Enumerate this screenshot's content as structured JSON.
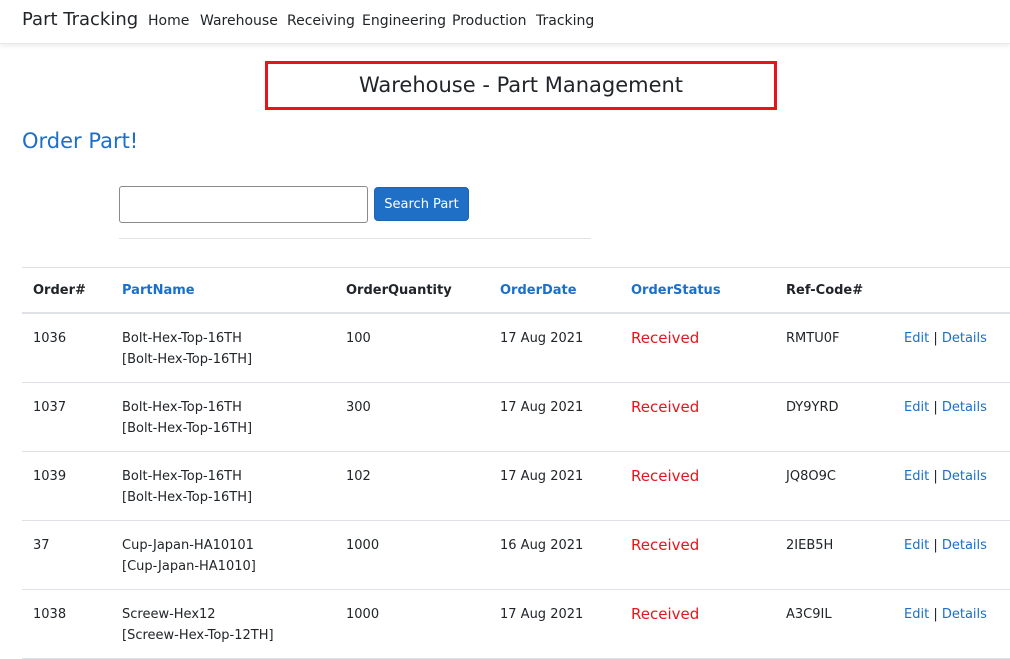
{
  "navbar": {
    "brand": "Part Tracking",
    "links": [
      {
        "label": "Home"
      },
      {
        "label": "Warehouse"
      },
      {
        "label": "Receiving"
      },
      {
        "label": "Engineering"
      },
      {
        "label": "Production"
      },
      {
        "label": "Tracking"
      }
    ]
  },
  "page": {
    "title": "Warehouse - Part Management",
    "order_link": "Order Part!"
  },
  "search": {
    "value": "",
    "placeholder": "",
    "button_label": "Search Part"
  },
  "table": {
    "headers": [
      "Order#",
      "PartName",
      "OrderQuantity",
      "OrderDate",
      "OrderStatus",
      "Ref-Code#",
      ""
    ],
    "rows": [
      {
        "order": "1036",
        "part_name": "Bolt-Hex-Top-16TH",
        "part_code": "[Bolt-Hex-Top-16TH]",
        "quantity": "100",
        "date": "17 Aug 2021",
        "status": "Received",
        "ref": "RMTU0F",
        "edit": "Edit",
        "sep": "|",
        "details": "Details"
      },
      {
        "order": "1037",
        "part_name": "Bolt-Hex-Top-16TH",
        "part_code": "[Bolt-Hex-Top-16TH]",
        "quantity": "300",
        "date": "17 Aug 2021",
        "status": "Received",
        "ref": "DY9YRD",
        "edit": "Edit",
        "sep": "|",
        "details": "Details"
      },
      {
        "order": "1039",
        "part_name": "Bolt-Hex-Top-16TH",
        "part_code": "[Bolt-Hex-Top-16TH]",
        "quantity": "102",
        "date": "17 Aug 2021",
        "status": "Received",
        "ref": "JQ8O9C",
        "edit": "Edit",
        "sep": "|",
        "details": "Details"
      },
      {
        "order": "37",
        "part_name": "Cup-Japan-HA10101",
        "part_code": "[Cup-Japan-HA1010]",
        "quantity": "1000",
        "date": "16 Aug 2021",
        "status": "Received",
        "ref": "2IEB5H",
        "edit": "Edit",
        "sep": "|",
        "details": "Details"
      },
      {
        "order": "1038",
        "part_name": "Screew-Hex12",
        "part_code": "[Screew-Hex-Top-12TH]",
        "quantity": "1000",
        "date": "17 Aug 2021",
        "status": "Received",
        "ref": "A3C9IL",
        "edit": "Edit",
        "sep": "|",
        "details": "Details"
      }
    ]
  },
  "colors": {
    "accent": "#1a6fc9",
    "button": "#1f6fc7",
    "status_received": "#e8141a",
    "highlight_box": "#e8141a"
  }
}
